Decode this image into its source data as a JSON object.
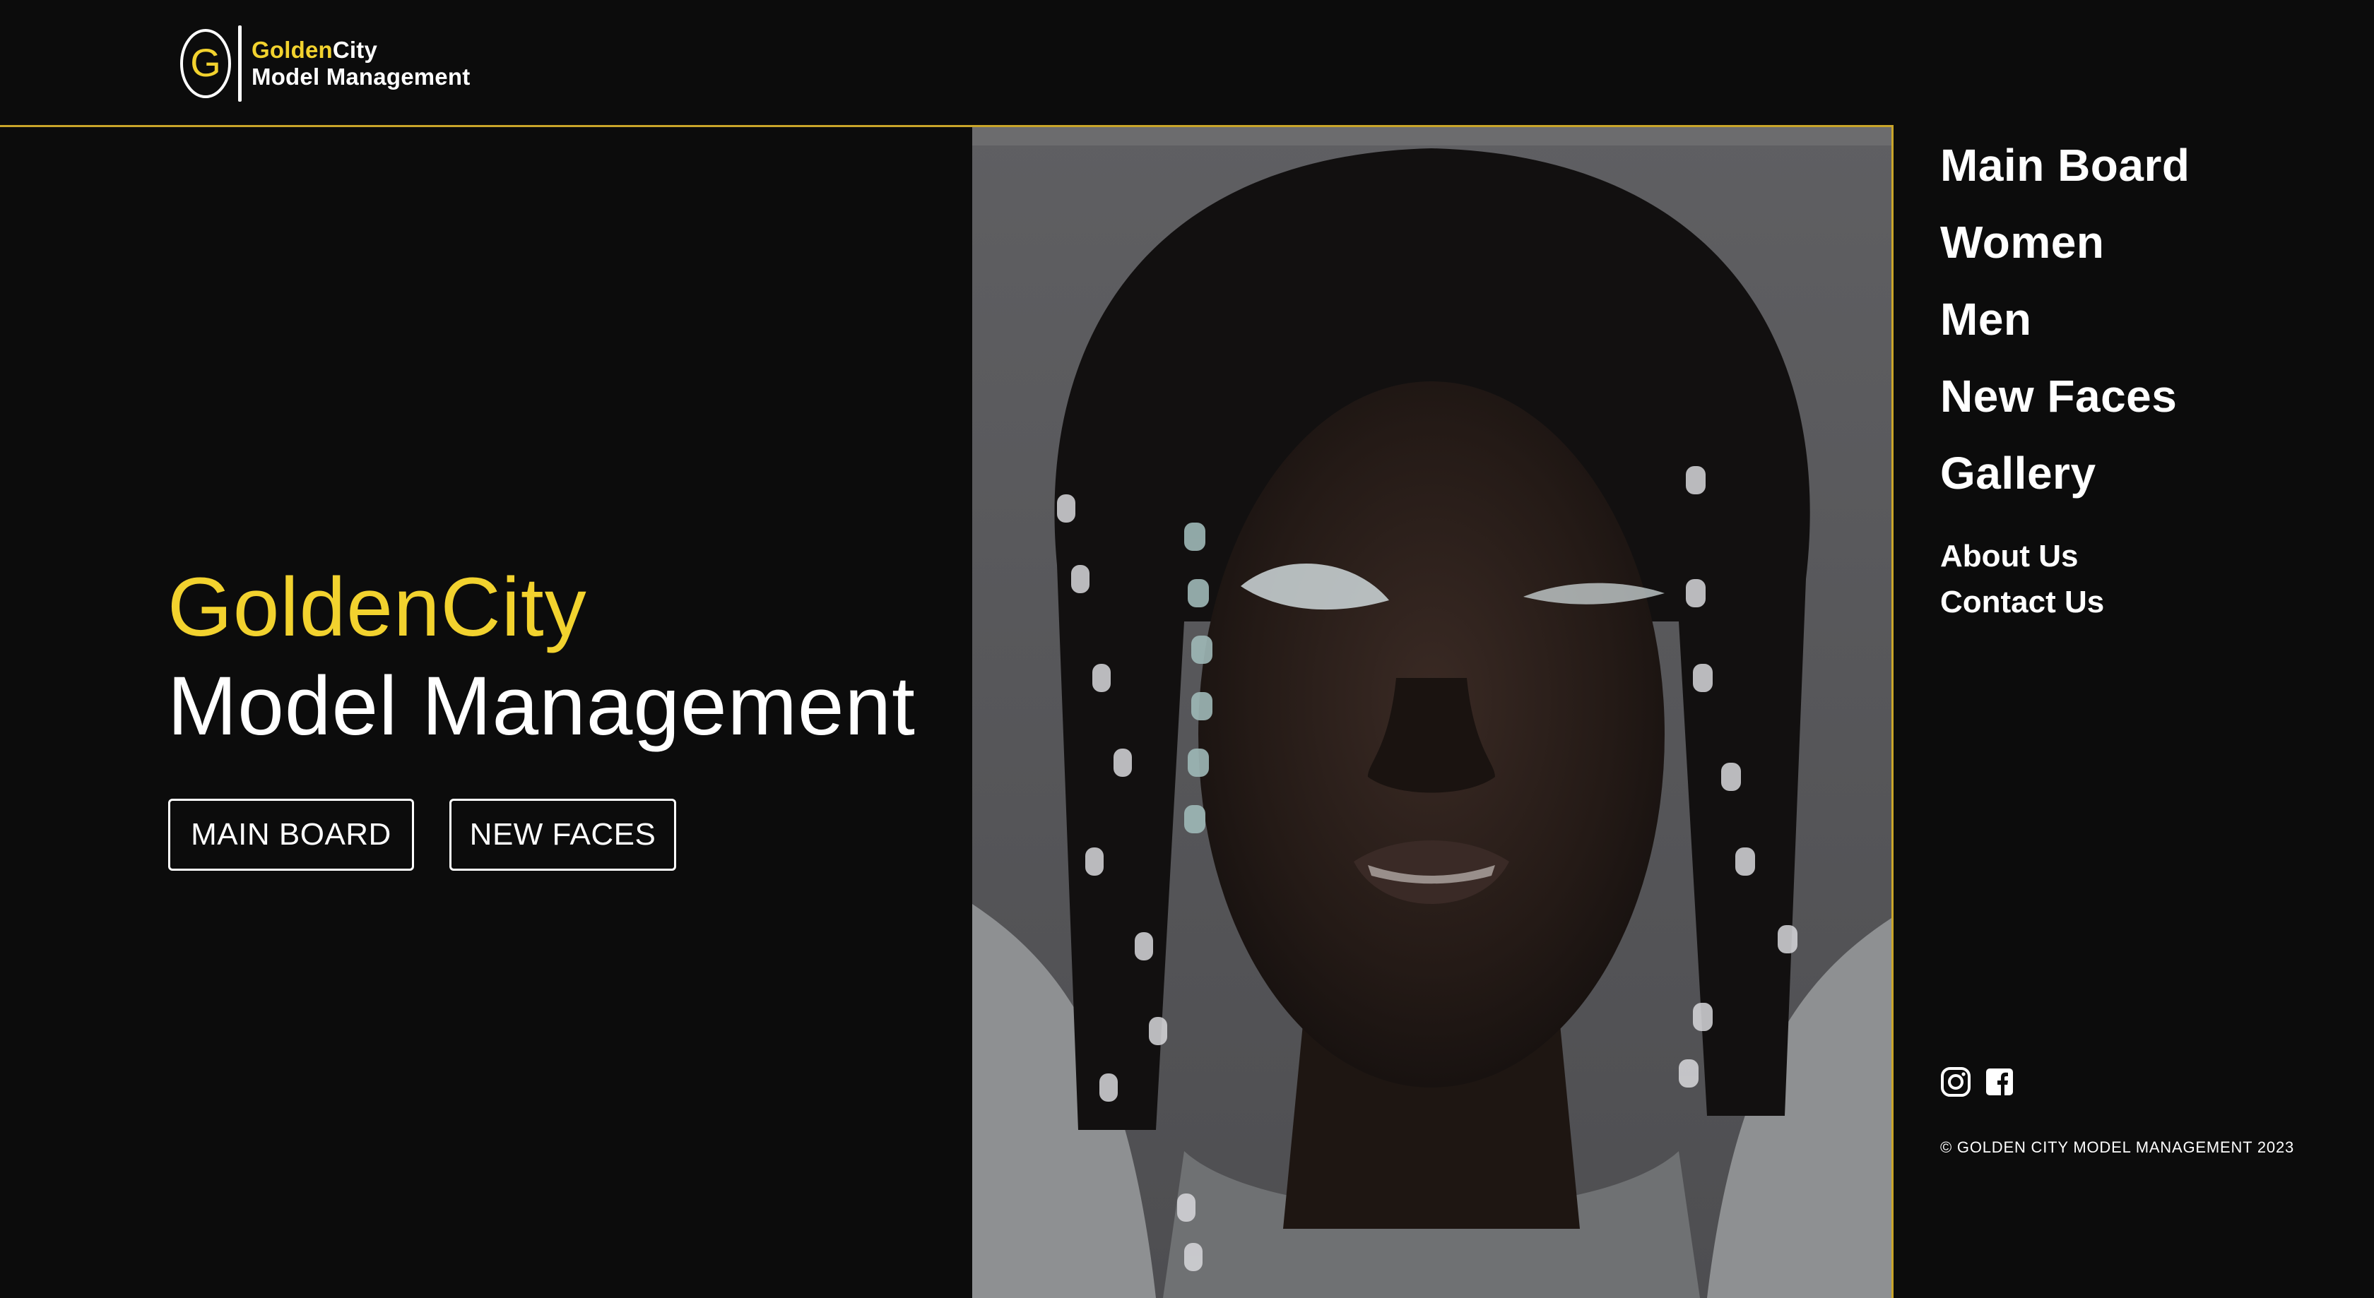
{
  "header": {
    "logo_letter": "G",
    "logo_name_gold": "Golden",
    "logo_name_white": "City",
    "logo_subtitle": "Model Management"
  },
  "hero": {
    "title_line1": "GoldenCity",
    "title_line2": "Model Management",
    "buttons": {
      "main_board": "MAIN BOARD",
      "new_faces": "NEW FACES"
    }
  },
  "nav": {
    "main_items": [
      {
        "label": "Main Board"
      },
      {
        "label": "Women"
      },
      {
        "label": "Men"
      },
      {
        "label": "New Faces"
      },
      {
        "label": "Gallery"
      }
    ],
    "secondary_items": [
      {
        "label": "About Us"
      },
      {
        "label": "Contact Us"
      }
    ]
  },
  "social": {
    "icons": [
      "instagram-icon",
      "facebook-icon"
    ]
  },
  "footer": {
    "copyright": "© GOLDEN CITY MODEL MANAGEMENT 2023"
  },
  "colors": {
    "background": "#0c0c0c",
    "accent_gold": "#f2d22e",
    "frame_gold": "#c9a52a",
    "text": "#ffffff"
  }
}
